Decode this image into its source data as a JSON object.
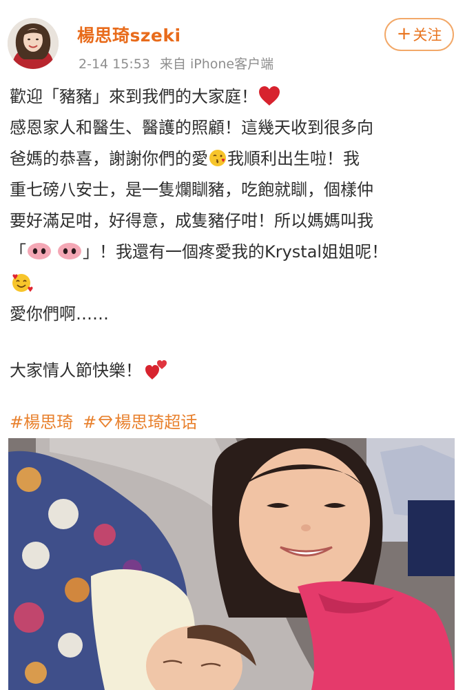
{
  "header": {
    "username": "楊思琦szeki",
    "timestamp": "2-14 15:53",
    "source": "来自 iPhone客户端",
    "follow_label": "关注",
    "follow_plus": "+",
    "avatar_icon": "avatar-icon",
    "verified_icon": "verified-badge-icon",
    "accent_color": "#e86b1b",
    "badge_color": "#f6b13c"
  },
  "post": {
    "line1": "歡迎「豬豬」來到我們的大家庭！",
    "line2": "感恩家人和醫生、醫護的照顧！這幾天收到很多向",
    "line3a": "爸媽的恭喜，謝謝你們的愛",
    "line3b": "我順利出生啦！我",
    "line4": "重七磅八安士，是一隻爛瞓豬，吃飽就瞓，個樣仲",
    "line5": "要好滿足咁，好得意，成隻豬仔咁！所以媽媽叫我",
    "line6a": "「",
    "line6b": "」！我還有一個疼愛我的Krystal姐姐呢！",
    "line8": "愛你們啊……",
    "line10": "大家情人節快樂！",
    "emojis": [
      "red-heart-icon",
      "kissing-face-icon",
      "pig-nose-icon",
      "pig-nose-icon",
      "smiling-face-with-hearts-icon",
      "two-hearts-icon"
    ]
  },
  "hashtags": {
    "tag1": "#楊思琦",
    "tag2_prefix": "#",
    "tag2_text": "楊思琦超话",
    "tag_color": "#e8812e",
    "supertopic_icon": "diamond-icon"
  },
  "photo": {
    "description_icon": "photo-girl-and-newborn-baby"
  }
}
